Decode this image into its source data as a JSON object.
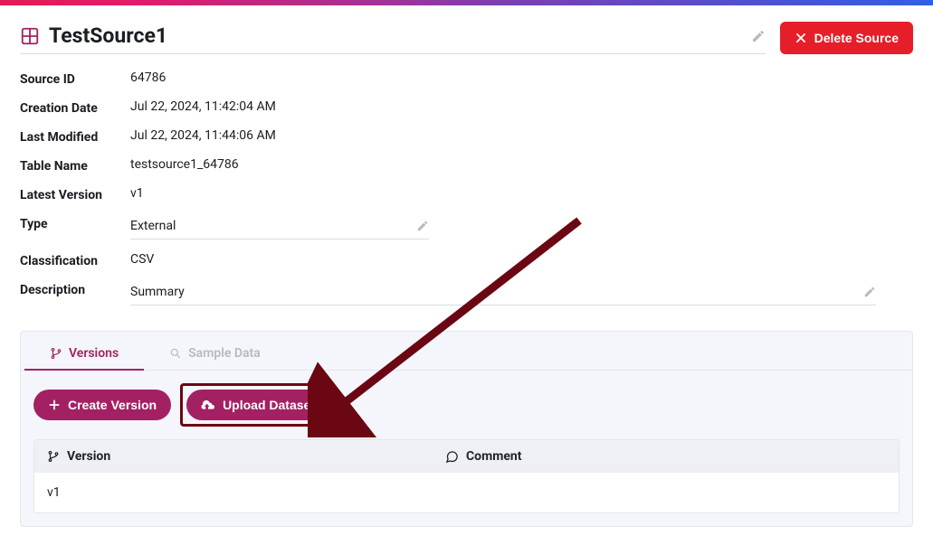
{
  "header": {
    "title": "TestSource1",
    "delete_label": "Delete Source"
  },
  "meta": {
    "source_id_label": "Source ID",
    "source_id": "64786",
    "creation_date_label": "Creation Date",
    "creation_date": "Jul 22, 2024, 11:42:04 AM",
    "last_modified_label": "Last Modified",
    "last_modified": "Jul 22, 2024, 11:44:06 AM",
    "table_name_label": "Table Name",
    "table_name": "testsource1_64786",
    "latest_version_label": "Latest Version",
    "latest_version": "v1",
    "type_label": "Type",
    "type": "External",
    "classification_label": "Classification",
    "classification": "CSV",
    "description_label": "Description",
    "description": "Summary"
  },
  "tabs": {
    "versions": "Versions",
    "sample_data": "Sample Data"
  },
  "buttons": {
    "create_version": "Create Version",
    "upload_dataset": "Upload Dataset"
  },
  "table": {
    "col_version": "Version",
    "col_comment": "Comment",
    "rows": [
      {
        "version": "v1",
        "comment": ""
      }
    ]
  }
}
